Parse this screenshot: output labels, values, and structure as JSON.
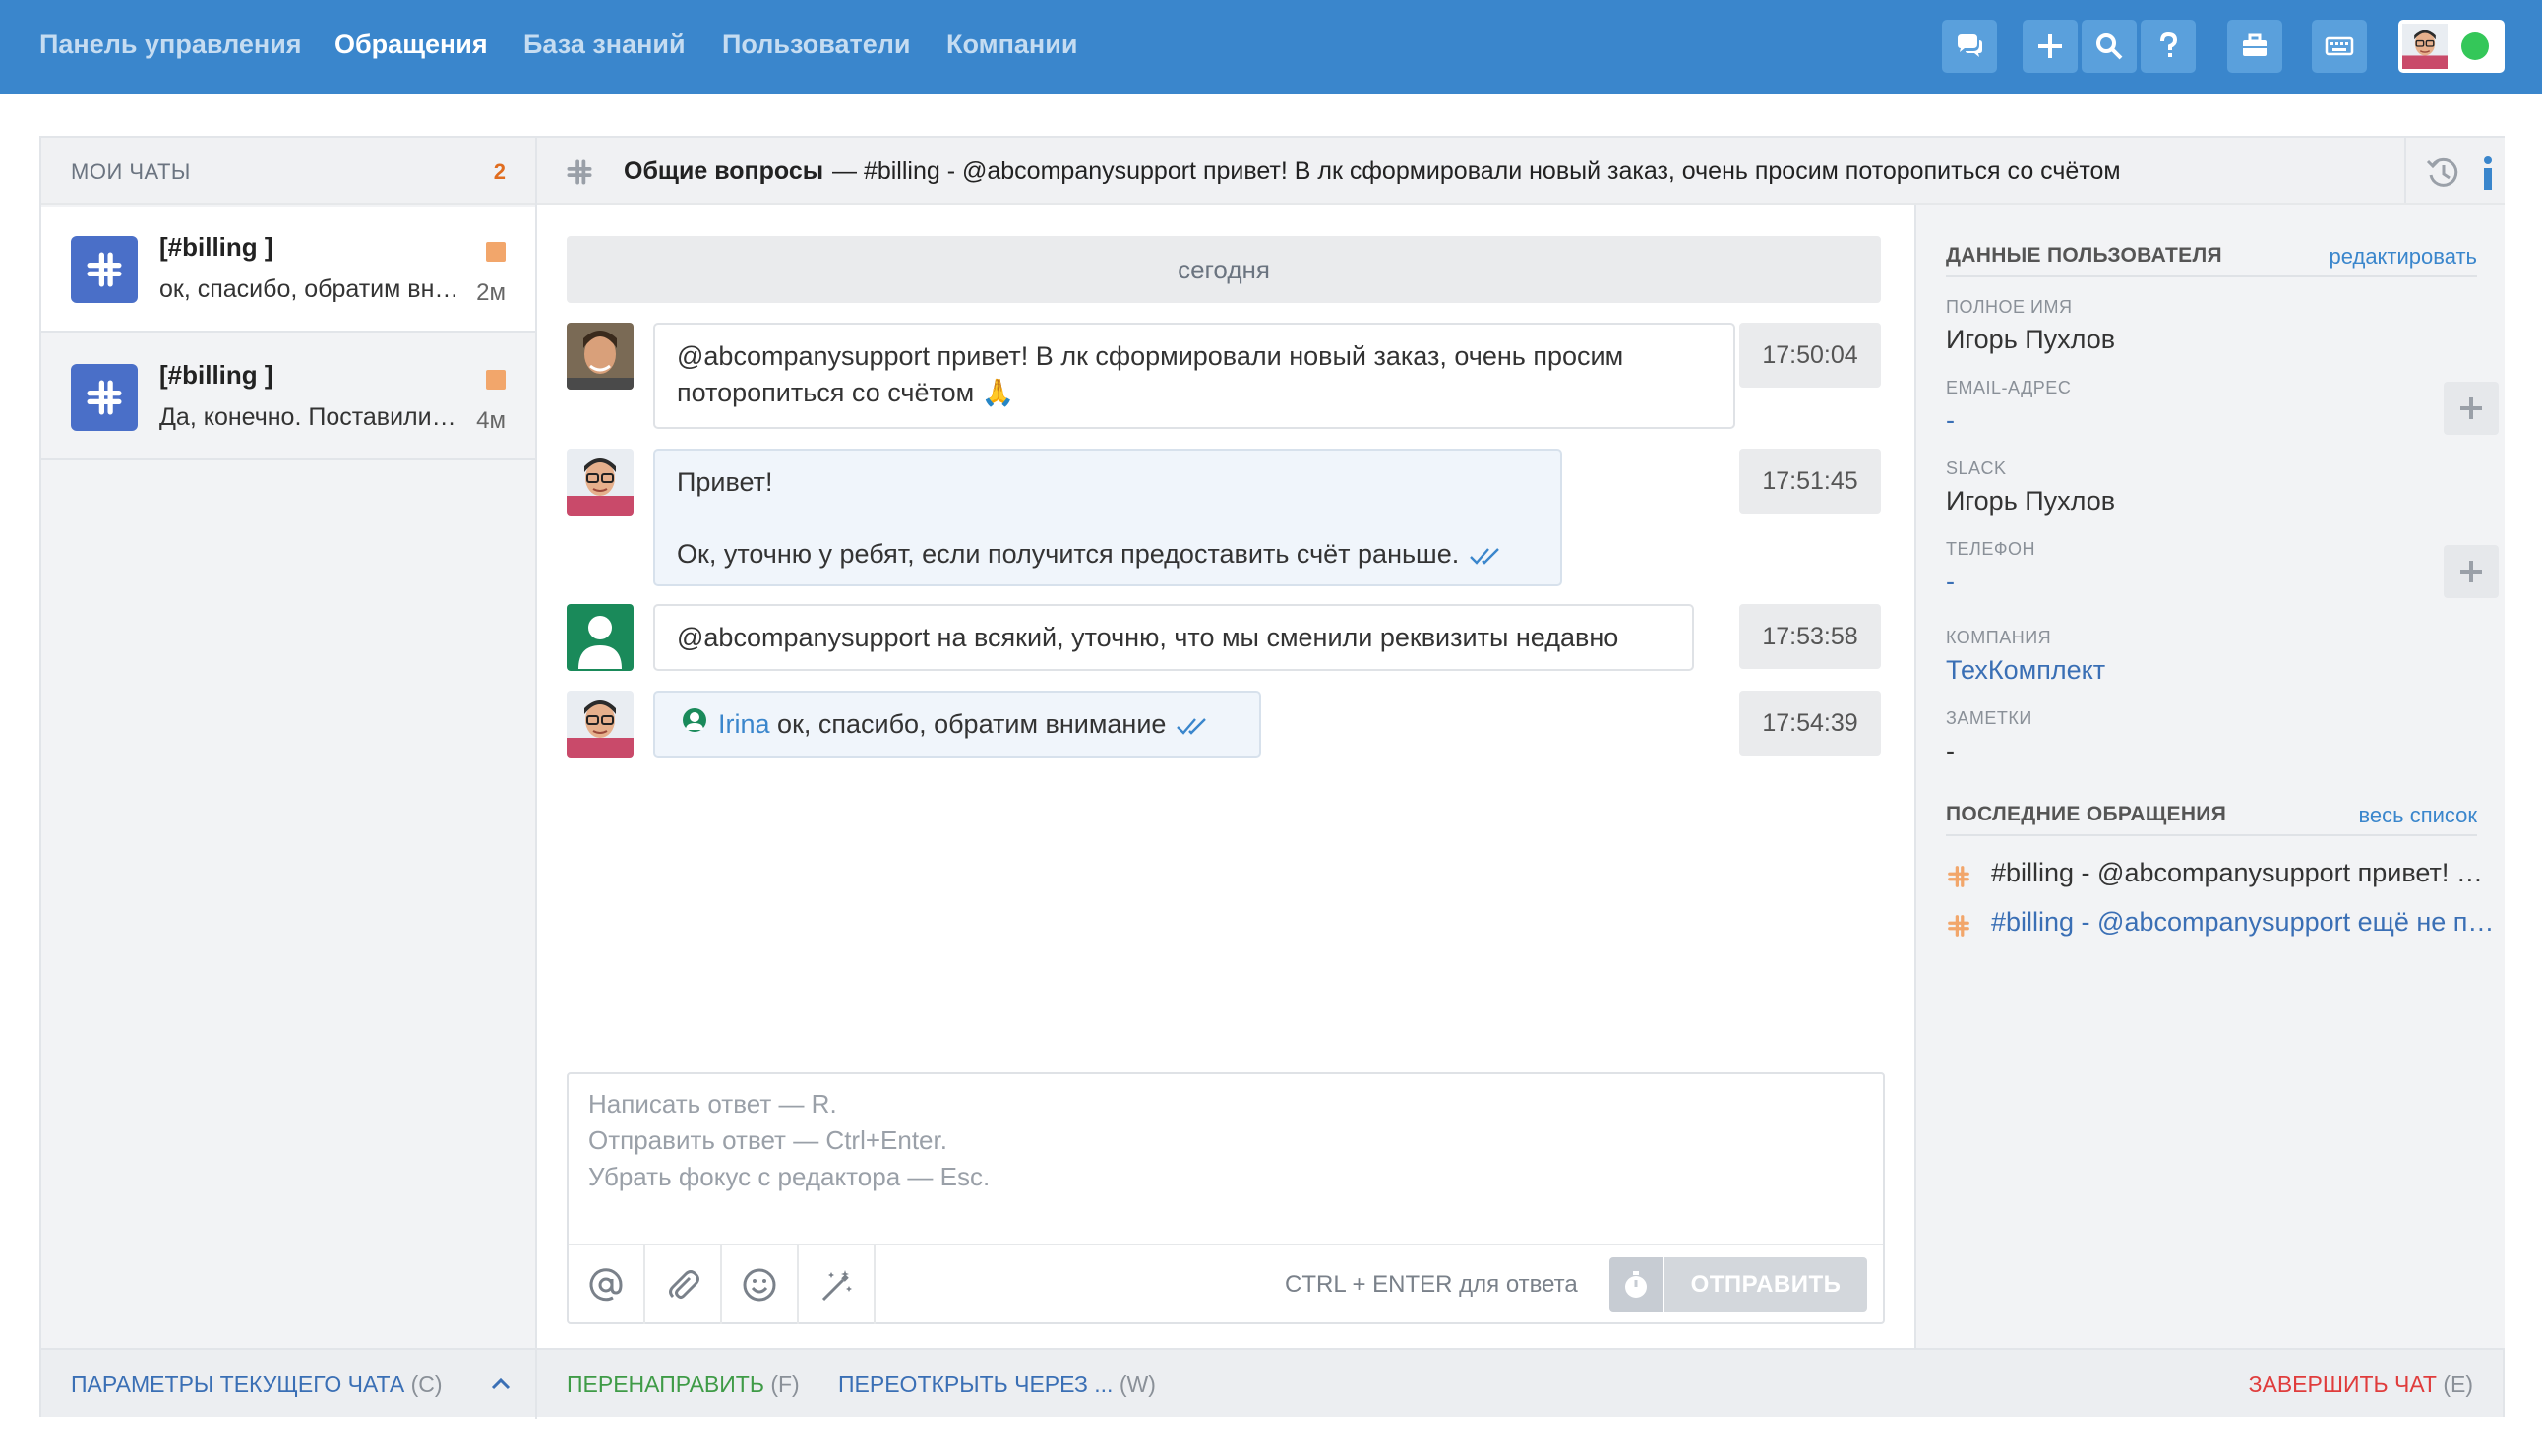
{
  "colors": {
    "topbar": "#3a86cc",
    "accent_orange": "#e06d1f",
    "online_green": "#34c759",
    "slack_icon_bg": "#4a6fc8",
    "link_blue": "#3a86cc",
    "forward_green": "#3f9b47",
    "finish_red": "#e03c3c"
  },
  "nav": {
    "dashboard": "Панель управления",
    "tickets": "Обращения",
    "knowledge": "База знаний",
    "users": "Пользователи",
    "companies": "Компании"
  },
  "toolbar_icons": [
    "chat-icon",
    "plus-icon",
    "search-icon",
    "help-icon",
    "briefcase-icon",
    "keyboard-icon"
  ],
  "chats": {
    "title": "МОИ ЧАТЫ",
    "count": "2",
    "items": [
      {
        "name": "[#billing ]",
        "message": "ок, спасибо, обратим внимание",
        "time": "2м"
      },
      {
        "name": "[#billing ]",
        "message": "Да, конечно. Поставили в приоритет",
        "time": "4м"
      }
    ]
  },
  "conversation": {
    "title": "Общие вопросы",
    "subtitle": "— #billing - @abcompanysupport привет! В лк сформировали новый заказ, очень просим поторопиться со счётом",
    "day": "сегодня",
    "messages": [
      {
        "line1": "@abcompanysupport привет! В лк сформировали новый заказ, очень просим",
        "line2": "поторопиться со счётом 🙏",
        "time": "17:50:04"
      },
      {
        "line1": "Привет!",
        "line2": "Ок, уточню у ребят, если получится предоставить счёт раньше.",
        "time": "17:51:45"
      },
      {
        "line1": "@abcompanysupport на всякий, уточню, что мы сменили реквизиты недавно",
        "time": "17:53:58"
      },
      {
        "mention": "Irina",
        "line1": "ок, спасибо, обратим внимание",
        "time": "17:54:39"
      }
    ]
  },
  "composer": {
    "placeholder": "Написать ответ — R.\nОтправить ответ — Ctrl+Enter.\nУбрать фокус с редактора — Esc.",
    "hint": "CTRL + ENTER для ответа",
    "send": "ОТПРАВИТЬ"
  },
  "user_data": {
    "title": "ДАННЫЕ ПОЛЬЗОВАТЕЛЯ",
    "edit": "редактировать",
    "full_name_label": "ПОЛНОЕ ИМЯ",
    "full_name": "Игорь Пухлов",
    "email_label": "EMAIL-АДРЕС",
    "email": "-",
    "slack_label": "SLACK",
    "slack": "Игорь Пухлов",
    "phone_label": "ТЕЛЕФОН",
    "phone": "-",
    "company_label": "КОМПАНИЯ",
    "company": "ТехКомплект",
    "notes_label": "ЗАМЕТКИ",
    "notes": "-"
  },
  "recent": {
    "title": "ПОСЛЕДНИЕ ОБРАЩЕНИЯ",
    "all": "весь список",
    "items": [
      "#billing - @abcompanysupport привет! В лк сформировали новый заказ",
      "#billing - @abcompanysupport ещё не пришёл счёт"
    ]
  },
  "bottom": {
    "params": "ПАРАМЕТРЫ ТЕКУЩЕГО ЧАТА",
    "params_key": "(C)",
    "forward": "ПЕРЕНАПРАВИТЬ",
    "forward_key": "(F)",
    "reopen": "ПЕРЕОТКРЫТЬ ЧЕРЕЗ ...",
    "reopen_key": "(W)",
    "finish": "ЗАВЕРШИТЬ ЧАТ",
    "finish_key": "(E)"
  }
}
